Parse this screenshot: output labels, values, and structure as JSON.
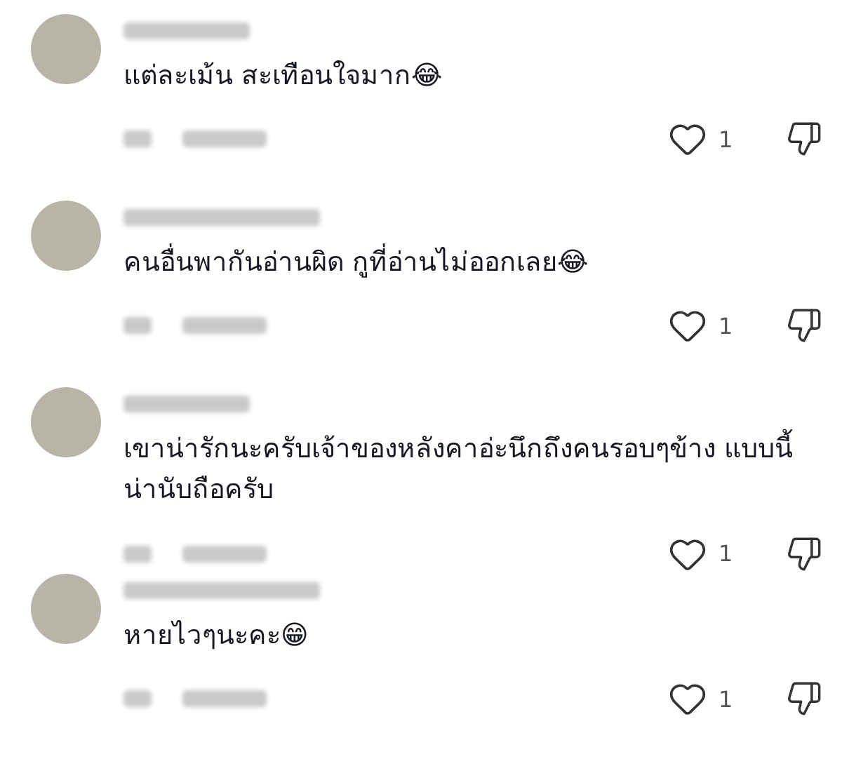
{
  "comments": [
    {
      "text": "แต่ละเม้น สะเทือนใจมาก😂",
      "likes": "1"
    },
    {
      "text": "คนอื่นพากันอ่านผิด กูที่อ่านไม่ออกเลย😂",
      "likes": "1"
    },
    {
      "text": "เขาน่ารักนะครับเจ้าของหลังคาอ่ะนึกถึงคนรอบๆข้าง แบบนี้น่านับถือครับ",
      "likes": "1"
    },
    {
      "text": "หายไวๆนะคะ😁",
      "likes": "1"
    }
  ]
}
